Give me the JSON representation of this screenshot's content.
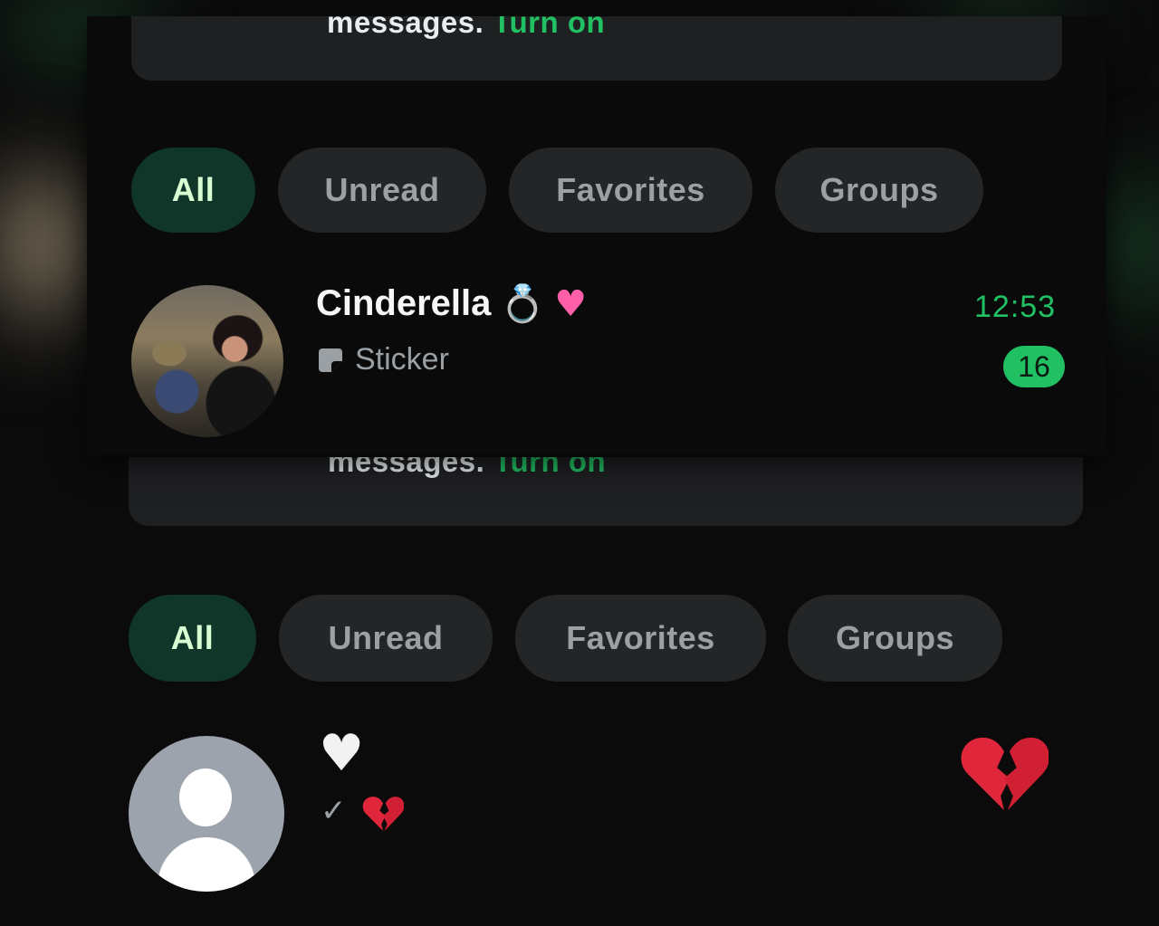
{
  "overlay": {
    "banner": {
      "text": "messages.",
      "action": "Turn on"
    },
    "filters": [
      {
        "label": "All",
        "active": true
      },
      {
        "label": "Unread",
        "active": false
      },
      {
        "label": "Favorites",
        "active": false
      },
      {
        "label": "Groups",
        "active": false
      }
    ],
    "chat": {
      "name": "Cinderella",
      "name_emojis": [
        "ring-icon",
        "pink-heart-icon"
      ],
      "preview_icon": "sticker-icon",
      "preview": "Sticker",
      "time": "12:53",
      "unread_count": "16"
    }
  },
  "background": {
    "banner": {
      "text": "messages.",
      "action": "Turn on"
    },
    "filters": [
      {
        "label": "All",
        "active": true
      },
      {
        "label": "Unread",
        "active": false
      },
      {
        "label": "Favorites",
        "active": false
      },
      {
        "label": "Groups",
        "active": false
      }
    ],
    "chat": {
      "name_icon": "white-heart-icon",
      "status_icon": "single-check-icon",
      "preview_icon": "broken-heart-icon",
      "trailing_icon": "broken-heart-icon"
    }
  },
  "colors": {
    "accent_green": "#21c063",
    "active_chip_bg": "#103529",
    "active_chip_text": "#d9fdd3",
    "chip_bg": "#232526",
    "background": "#0b0b0b"
  }
}
